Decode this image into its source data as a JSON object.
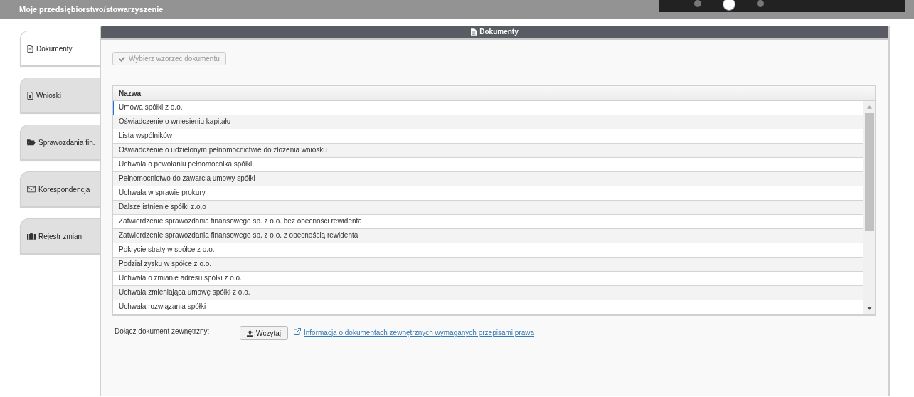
{
  "page_title": "Moje przedsiębiorstwo/stowarzyszenie",
  "tabs": [
    {
      "label": "Dokumenty",
      "selected": true
    },
    {
      "label": "Wnioski",
      "selected": false
    },
    {
      "label": "Sprawozdania fin.",
      "selected": false
    },
    {
      "label": "Korespondencja",
      "selected": false
    },
    {
      "label": "Rejestr zmian",
      "selected": false
    }
  ],
  "panel": {
    "title": "Dokumenty",
    "template_button": {
      "label": "Wybierz wzorzec dokumentu",
      "disabled": true
    },
    "table": {
      "columns": [
        "Nazwa"
      ],
      "rows": [
        {
          "name": "Umowa spółki z o.o.",
          "selected": true
        },
        {
          "name": "Oświadczenie o wniesieniu kapitału",
          "selected": false
        },
        {
          "name": "Lista wspólników",
          "selected": false
        },
        {
          "name": "Oświadczenie o udzielonym pełnomocnictwie do złożenia wniosku",
          "selected": false
        },
        {
          "name": "Uchwała o powołaniu pełnomocnika spółki",
          "selected": false
        },
        {
          "name": "Pełnomocnictwo do zawarcia umowy spółki",
          "selected": false
        },
        {
          "name": "Uchwała w sprawie prokury",
          "selected": false
        },
        {
          "name": "Dalsze istnienie spółki z.o.o",
          "selected": false
        },
        {
          "name": "Zatwierdzenie sprawozdania finansowego sp. z o.o. bez obecności rewidenta",
          "selected": false
        },
        {
          "name": "Zatwierdzenie sprawozdania finansowego sp. z o.o. z obecnością rewidenta",
          "selected": false
        },
        {
          "name": "Pokrycie straty w spółce z o.o.",
          "selected": false
        },
        {
          "name": "Podział zysku w spółce z o.o.",
          "selected": false
        },
        {
          "name": "Uchwała o zmianie adresu spółki z o.o.",
          "selected": false
        },
        {
          "name": "Uchwała zmieniająca umowę spółki z o.o.",
          "selected": false
        },
        {
          "name": "Uchwała rozwiązania spółki",
          "selected": false
        }
      ]
    },
    "attach_label": "Dołącz dokument zewnętrzny:",
    "upload_button": "Wczytaj",
    "info_link": "Informacja o dokumentach zewnętrznych wymaganych przepisami prawa"
  }
}
